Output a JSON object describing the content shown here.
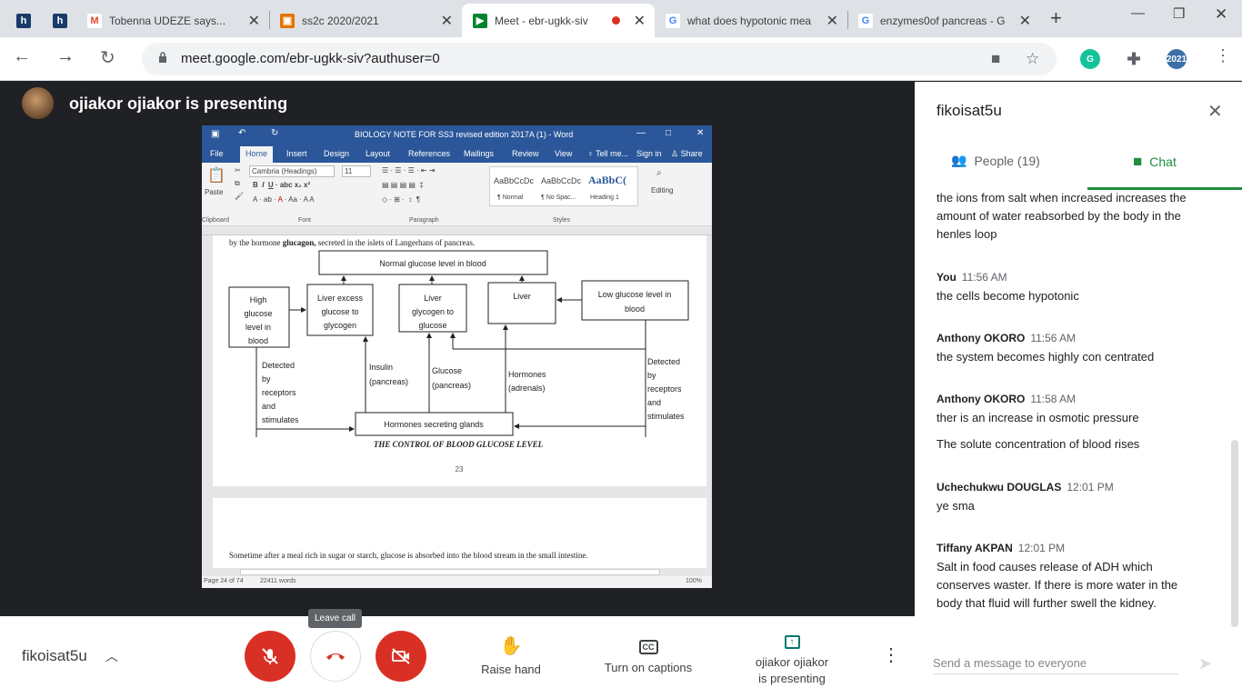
{
  "browser": {
    "tabs": [
      {
        "label": "h",
        "icon": "h",
        "color": "#1a3a6b"
      },
      {
        "label": "h",
        "icon": "h",
        "color": "#1a3a6b"
      },
      {
        "label": "Tobenna UDEZE says...",
        "icon": "M",
        "color": "#ea4335"
      },
      {
        "label": "ss2c 2020/2021",
        "icon": "▣",
        "color": "#e37400"
      },
      {
        "label": "Meet - ebr-ugkk-siv",
        "icon": "▶",
        "color": "#00832d"
      },
      {
        "label": "what does hypotonic mea",
        "icon": "G",
        "color": "#4285f4"
      },
      {
        "label": "enzymes0of pancreas - G",
        "icon": "G",
        "color": "#4285f4"
      }
    ],
    "url": "meet.google.com/ebr-ugkk-siv?authuser=0",
    "profile_badge": "2021"
  },
  "presenter": {
    "title": "ojiakor ojiakor is presenting"
  },
  "word": {
    "title": "BIOLOGY NOTE  FOR SS3 revised edition 2017A (1) - Word",
    "tabs": [
      "File",
      "Home",
      "Insert",
      "Design",
      "Layout",
      "References",
      "Mailings",
      "Review",
      "View",
      "Tell me...",
      "Sign in",
      "Share"
    ],
    "font_name": "Cambria (Headings)",
    "font_size": "11",
    "paste": "Paste",
    "editing": "Editing",
    "groups": [
      "Clipboard",
      "Font",
      "Paragraph",
      "Styles"
    ],
    "styles": [
      {
        "preview": "AaBbCcDc",
        "name": "¶ Normal"
      },
      {
        "preview": "AaBbCcDc",
        "name": "¶ No Spac..."
      },
      {
        "preview": "AaBbC(",
        "name": "Heading 1"
      }
    ],
    "line1_pre": "by the hormone ",
    "line1_bold": "glucagon,",
    "line1_post": " secreted in the islets of Langerhans of pancreas.",
    "diagram": {
      "top": "Normal glucose level in blood",
      "high": [
        "High",
        "glucose",
        "level in",
        "blood"
      ],
      "liver_excess": [
        "Liver excess",
        "glucose to",
        "glycogen"
      ],
      "liver_glycogen": [
        "Liver",
        "glycogen to",
        "glucose"
      ],
      "liver": "Liver",
      "low": [
        "Low glucose level in",
        "blood"
      ],
      "detected_left": [
        "Detected",
        "by",
        "receptors",
        "and",
        "stimulates"
      ],
      "insulin": [
        "Insulin",
        "(pancreas)"
      ],
      "glucose": [
        "Glucose",
        "(pancreas)"
      ],
      "hormones": [
        "Hormones",
        "(adrenals)"
      ],
      "detected_right": [
        "Detected",
        "by",
        "receptors",
        "and",
        "stimulates"
      ],
      "glands": "Hormones secreting glands",
      "caption": "THE CONTROL OF BLOOD GLUCOSE LEVEL"
    },
    "page_number": "23",
    "line2": "Sometime after a meal rich in sugar or starch, glucose is absorbed into the blood stream in the small intestine.",
    "status_page": "Page 24 of 74",
    "status_words": "22411 words",
    "zoom": "100%"
  },
  "controls": {
    "self_name": "fikoisat5u",
    "tooltip": "Leave call",
    "raise_hand": "Raise hand",
    "captions": "Turn on captions",
    "presenting_line1": "ojiakor ojiakor",
    "presenting_line2": "is presenting"
  },
  "sidebar": {
    "title": "fikoisat5u",
    "people_tab": "People (19)",
    "chat_tab": "Chat",
    "input_placeholder": "Send a message to everyone",
    "messages": [
      {
        "sender": "",
        "time": "",
        "text": "the ions from salt when increased increases the amount of water reabsorbed by the body in the henles loop"
      },
      {
        "sender": "You",
        "time": "11:56 AM",
        "text": "the cells become hypotonic"
      },
      {
        "sender": "Anthony OKORO",
        "time": "11:56 AM",
        "text": "the system becomes highly con centrated"
      },
      {
        "sender": "Anthony OKORO",
        "time": "11:58 AM",
        "text": "ther is an increase in osmotic pressure"
      },
      {
        "sender": "",
        "time": "",
        "text": "The solute concentration of blood rises"
      },
      {
        "sender": "Uchechukwu DOUGLAS",
        "time": "12:01 PM",
        "text": "ye sma"
      },
      {
        "sender": "Tiffany AKPAN",
        "time": "12:01 PM",
        "text": "Salt in food causes release of ADH which conserves waster. If there is more water in the body that fluid will further swell the kidney."
      }
    ]
  },
  "colors": {
    "accent_green": "#1e8e3e",
    "danger_red": "#d93025",
    "word_blue": "#2b579a"
  }
}
